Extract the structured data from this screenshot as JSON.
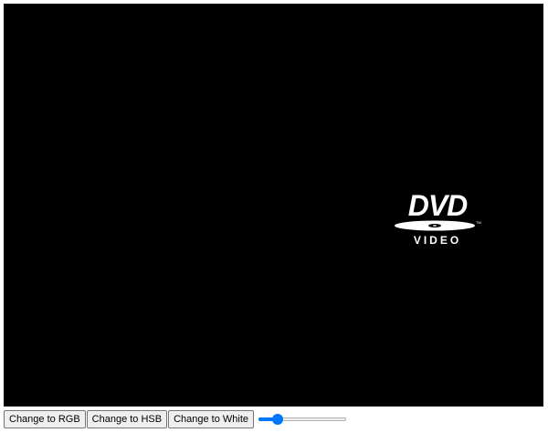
{
  "stage": {
    "background": "#000000",
    "logo": {
      "icon": "dvd-video-logo-icon",
      "wordmark": "DVD",
      "subtitle": "VIDEO",
      "trademark": "TM",
      "color": "#ffffff"
    }
  },
  "controls": {
    "rgb_label": "Change to RGB",
    "hsb_label": "Change to HSB",
    "white_label": "Change to White",
    "speed_slider": {
      "value_fraction": 0.18,
      "accent": "#0075ff"
    }
  }
}
